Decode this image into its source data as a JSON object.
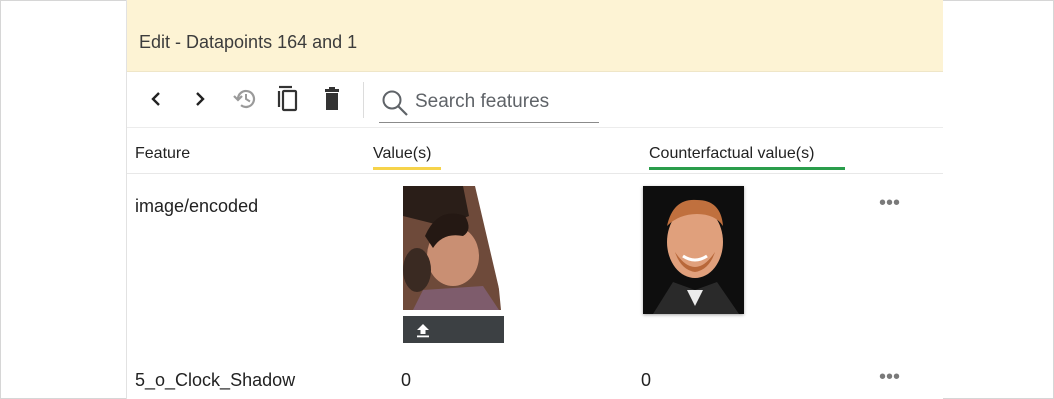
{
  "panel": {
    "title": "Edit - Datapoints 164 and 1"
  },
  "toolbar": {
    "buttons": [
      {
        "name": "previous-icon"
      },
      {
        "name": "next-icon"
      },
      {
        "name": "history-icon"
      },
      {
        "name": "duplicate-icon"
      },
      {
        "name": "delete-icon"
      }
    ],
    "search_placeholder": "Search features"
  },
  "table": {
    "headers": {
      "feature": "Feature",
      "value": "Value(s)",
      "counterfactual": "Counterfactual value(s)"
    },
    "rows": [
      {
        "feature": "image/encoded",
        "value": "",
        "counterfactual": ""
      },
      {
        "feature": "5_o_Clock_Shadow",
        "value": "0",
        "counterfactual": "0"
      }
    ]
  },
  "colors": {
    "title_bg": "#fdf3d4",
    "value_underline": "#f6d34a",
    "counterfactual_underline": "#2a9d4b"
  }
}
